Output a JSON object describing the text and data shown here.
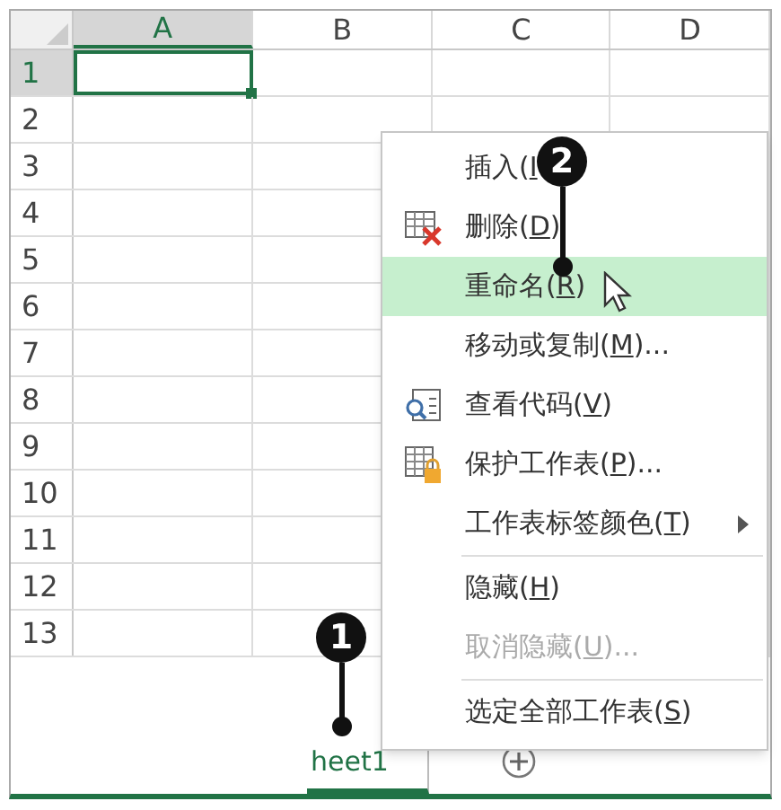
{
  "columns": [
    {
      "label": "A",
      "selected": true
    },
    {
      "label": "B",
      "selected": false
    },
    {
      "label": "C",
      "selected": false
    },
    {
      "label": "D",
      "selected": false
    }
  ],
  "rows": [
    {
      "label": "1",
      "selected": true
    },
    {
      "label": "2",
      "selected": false
    },
    {
      "label": "3",
      "selected": false
    },
    {
      "label": "4",
      "selected": false
    },
    {
      "label": "5",
      "selected": false
    },
    {
      "label": "6",
      "selected": false
    },
    {
      "label": "7",
      "selected": false
    },
    {
      "label": "8",
      "selected": false
    },
    {
      "label": "9",
      "selected": false
    },
    {
      "label": "10",
      "selected": false
    },
    {
      "label": "11",
      "selected": false
    },
    {
      "label": "12",
      "selected": false
    },
    {
      "label": "13",
      "selected": false
    }
  ],
  "menu": {
    "items": [
      {
        "kind": "item",
        "before": "插入(",
        "key": "I",
        "selected": false,
        "disabled": false,
        "submenu": false
      },
      {
        "kind": "item",
        "before": "删除(",
        "key": "D",
        "after": ")",
        "selected": false,
        "disabled": false,
        "submenu": false
      },
      {
        "kind": "item",
        "before": "重命名(",
        "key": "R",
        "after": ")",
        "selected": true,
        "disabled": false,
        "submenu": false
      },
      {
        "kind": "item",
        "before": "移动或复制(",
        "key": "M",
        "after": ")...",
        "selected": false,
        "disabled": false,
        "submenu": false
      },
      {
        "kind": "item",
        "before": "查看代码(",
        "key": "V",
        "after": ")",
        "selected": false,
        "disabled": false,
        "submenu": false
      },
      {
        "kind": "item",
        "before": "保护工作表(",
        "key": "P",
        "after": ")...",
        "selected": false,
        "disabled": false,
        "submenu": false
      },
      {
        "kind": "item",
        "before": "工作表标签颜色(",
        "key": "T",
        "after": ")",
        "selected": false,
        "disabled": false,
        "submenu": true
      },
      {
        "kind": "separator"
      },
      {
        "kind": "item",
        "before": "隐藏(",
        "key": "H",
        "after": ")",
        "selected": false,
        "disabled": false,
        "submenu": false
      },
      {
        "kind": "item",
        "before": "取消隐藏(",
        "key": "U",
        "after": ")...",
        "selected": false,
        "disabled": true,
        "submenu": false
      },
      {
        "kind": "separator"
      },
      {
        "kind": "item",
        "before": "选定全部工作表(",
        "key": "S",
        "after": ")",
        "selected": false,
        "disabled": false,
        "submenu": false
      }
    ]
  },
  "sheet_tabs": [
    {
      "label": "heet1",
      "selected": true
    }
  ],
  "callouts": [
    {
      "number": "1"
    },
    {
      "number": "2"
    }
  ]
}
